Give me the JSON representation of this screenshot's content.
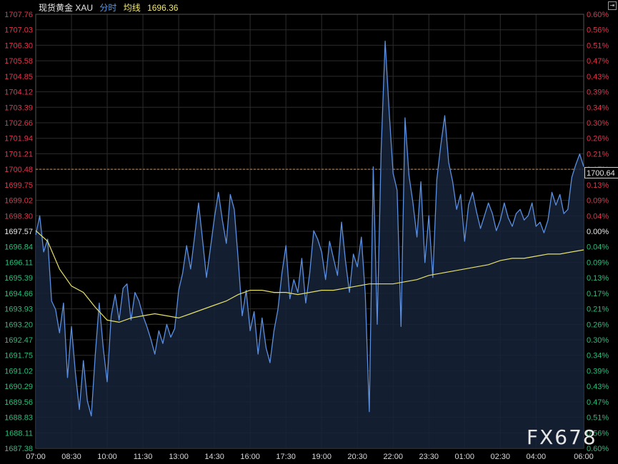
{
  "header": {
    "symbol": "现货黄金 XAU",
    "mode": "分时",
    "avg_label": "均线",
    "avg_value": "1696.36"
  },
  "current_price_tag": "1700.64",
  "watermark": "FX678",
  "colors": {
    "background": "#000000",
    "price_line": "#5b8fe0",
    "area_fill": "#16233a",
    "avg_line": "#e6e16a",
    "axis_up": "#e8334a",
    "axis_down": "#26c07a",
    "grid": "#2c2c2c",
    "ref_line": "#d28a4a"
  },
  "chart_data": {
    "type": "line",
    "title": "",
    "xlabel": "",
    "ylabel": "",
    "x_ticks": [
      "07:00",
      "08:30",
      "10:00",
      "11:30",
      "13:00",
      "14:30",
      "16:00",
      "17:30",
      "19:00",
      "20:30",
      "22:00",
      "23:30",
      "01:00",
      "02:30",
      "04:00",
      "06:00"
    ],
    "y_ticks": [
      "1707.76",
      "1707.03",
      "1706.30",
      "1705.58",
      "1704.85",
      "1704.12",
      "1703.39",
      "1702.66",
      "1701.94",
      "1701.21",
      "1700.48",
      "1699.75",
      "1699.02",
      "1698.30",
      "1697.57",
      "1696.84",
      "1696.11",
      "1695.39",
      "1694.66",
      "1693.93",
      "1693.20",
      "1692.47",
      "1691.75",
      "1691.02",
      "1690.29",
      "1689.56",
      "1688.83",
      "1688.11",
      "1687.38"
    ],
    "pct_ticks": [
      "0.60%",
      "0.56%",
      "0.51%",
      "0.47%",
      "0.43%",
      "0.39%",
      "0.34%",
      "0.30%",
      "0.26%",
      "0.21%",
      "0.17%",
      "0.13%",
      "0.09%",
      "0.04%",
      "0.00%",
      "0.04%",
      "0.09%",
      "0.13%",
      "0.17%",
      "0.21%",
      "0.26%",
      "0.30%",
      "0.34%",
      "0.39%",
      "0.43%",
      "0.47%",
      "0.51%",
      "0.56%",
      "0.60%"
    ],
    "ylim": [
      1687.38,
      1707.76
    ],
    "prev_close": 1697.57,
    "ref_price": 1700.48,
    "grid": true,
    "series": [
      {
        "key": "price",
        "points": [
          [
            "07:00",
            1697.4
          ],
          [
            "07:10",
            1698.3
          ],
          [
            "07:20",
            1696.6
          ],
          [
            "07:30",
            1697.2
          ],
          [
            "07:40",
            1694.3
          ],
          [
            "07:50",
            1693.9
          ],
          [
            "08:00",
            1692.8
          ],
          [
            "08:10",
            1694.2
          ],
          [
            "08:20",
            1690.7
          ],
          [
            "08:30",
            1693.1
          ],
          [
            "08:40",
            1690.9
          ],
          [
            "08:50",
            1689.2
          ],
          [
            "09:00",
            1691.5
          ],
          [
            "09:10",
            1689.6
          ],
          [
            "09:20",
            1688.9
          ],
          [
            "09:30",
            1691.8
          ],
          [
            "09:40",
            1694.2
          ],
          [
            "09:50",
            1692.1
          ],
          [
            "10:00",
            1690.5
          ],
          [
            "10:10",
            1693.6
          ],
          [
            "10:20",
            1694.6
          ],
          [
            "10:30",
            1693.4
          ],
          [
            "10:40",
            1694.9
          ],
          [
            "10:50",
            1695.1
          ],
          [
            "11:00",
            1693.4
          ],
          [
            "11:10",
            1694.7
          ],
          [
            "11:20",
            1694.3
          ],
          [
            "11:30",
            1693.6
          ],
          [
            "11:40",
            1693.1
          ],
          [
            "11:50",
            1692.5
          ],
          [
            "12:00",
            1691.8
          ],
          [
            "12:10",
            1692.9
          ],
          [
            "12:20",
            1692.3
          ],
          [
            "12:30",
            1693.2
          ],
          [
            "12:40",
            1692.6
          ],
          [
            "12:50",
            1693.0
          ],
          [
            "13:00",
            1694.8
          ],
          [
            "13:10",
            1695.6
          ],
          [
            "13:20",
            1696.9
          ],
          [
            "13:30",
            1695.8
          ],
          [
            "13:40",
            1697.3
          ],
          [
            "13:50",
            1698.9
          ],
          [
            "14:00",
            1697.2
          ],
          [
            "14:10",
            1695.4
          ],
          [
            "14:20",
            1696.8
          ],
          [
            "14:30",
            1698.2
          ],
          [
            "14:40",
            1699.4
          ],
          [
            "14:50",
            1698.1
          ],
          [
            "15:00",
            1697.0
          ],
          [
            "15:10",
            1699.3
          ],
          [
            "15:20",
            1698.6
          ],
          [
            "15:30",
            1696.2
          ],
          [
            "15:40",
            1693.6
          ],
          [
            "15:50",
            1694.8
          ],
          [
            "16:00",
            1692.9
          ],
          [
            "16:10",
            1693.8
          ],
          [
            "16:20",
            1691.8
          ],
          [
            "16:30",
            1693.5
          ],
          [
            "16:40",
            1692.1
          ],
          [
            "16:50",
            1691.4
          ],
          [
            "17:00",
            1692.9
          ],
          [
            "17:10",
            1693.9
          ],
          [
            "17:20",
            1695.6
          ],
          [
            "17:30",
            1696.9
          ],
          [
            "17:40",
            1694.4
          ],
          [
            "17:50",
            1695.3
          ],
          [
            "18:00",
            1694.7
          ],
          [
            "18:10",
            1696.3
          ],
          [
            "18:20",
            1694.2
          ],
          [
            "18:30",
            1695.6
          ],
          [
            "18:40",
            1697.6
          ],
          [
            "18:50",
            1697.2
          ],
          [
            "19:00",
            1696.6
          ],
          [
            "19:10",
            1695.3
          ],
          [
            "19:20",
            1697.1
          ],
          [
            "19:30",
            1696.3
          ],
          [
            "19:40",
            1695.5
          ],
          [
            "19:50",
            1698.0
          ],
          [
            "20:00",
            1696.2
          ],
          [
            "20:10",
            1694.7
          ],
          [
            "20:20",
            1696.5
          ],
          [
            "20:30",
            1695.9
          ],
          [
            "20:40",
            1697.3
          ],
          [
            "20:50",
            1694.6
          ],
          [
            "21:00",
            1689.1
          ],
          [
            "21:10",
            1700.6
          ],
          [
            "21:20",
            1693.2
          ],
          [
            "21:30",
            1701.4
          ],
          [
            "21:40",
            1706.5
          ],
          [
            "21:50",
            1703.2
          ],
          [
            "22:00",
            1700.3
          ],
          [
            "22:10",
            1699.5
          ],
          [
            "22:20",
            1693.1
          ],
          [
            "22:30",
            1702.9
          ],
          [
            "22:40",
            1700.2
          ],
          [
            "22:50",
            1698.9
          ],
          [
            "23:00",
            1697.3
          ],
          [
            "23:10",
            1699.9
          ],
          [
            "23:20",
            1696.1
          ],
          [
            "23:30",
            1698.3
          ],
          [
            "23:40",
            1695.4
          ],
          [
            "23:50",
            1700.0
          ],
          [
            "00:00",
            1701.6
          ],
          [
            "00:10",
            1703.0
          ],
          [
            "00:20",
            1700.8
          ],
          [
            "00:30",
            1699.9
          ],
          [
            "00:40",
            1698.6
          ],
          [
            "00:50",
            1699.3
          ],
          [
            "01:00",
            1697.1
          ],
          [
            "01:10",
            1698.8
          ],
          [
            "01:20",
            1699.4
          ],
          [
            "01:30",
            1698.5
          ],
          [
            "01:40",
            1697.7
          ],
          [
            "01:50",
            1698.3
          ],
          [
            "02:00",
            1698.9
          ],
          [
            "02:10",
            1698.4
          ],
          [
            "02:20",
            1697.6
          ],
          [
            "02:30",
            1698.1
          ],
          [
            "02:40",
            1698.9
          ],
          [
            "02:50",
            1698.2
          ],
          [
            "03:00",
            1697.8
          ],
          [
            "03:10",
            1698.4
          ],
          [
            "03:20",
            1698.6
          ],
          [
            "03:30",
            1698.1
          ],
          [
            "03:40",
            1698.3
          ],
          [
            "03:50",
            1698.9
          ],
          [
            "04:00",
            1697.8
          ],
          [
            "04:10",
            1698.0
          ],
          [
            "04:20",
            1697.5
          ],
          [
            "04:30",
            1698.1
          ],
          [
            "04:40",
            1699.4
          ],
          [
            "04:50",
            1698.8
          ],
          [
            "05:00",
            1699.3
          ],
          [
            "05:10",
            1698.4
          ],
          [
            "05:20",
            1698.6
          ],
          [
            "05:30",
            1700.1
          ],
          [
            "05:40",
            1700.7
          ],
          [
            "05:50",
            1701.2
          ],
          [
            "06:00",
            1700.6
          ]
        ]
      },
      {
        "key": "average",
        "points": [
          [
            "07:00",
            1697.6
          ],
          [
            "07:30",
            1697.1
          ],
          [
            "08:00",
            1695.8
          ],
          [
            "08:30",
            1695.0
          ],
          [
            "09:00",
            1694.7
          ],
          [
            "09:30",
            1694.0
          ],
          [
            "10:00",
            1693.4
          ],
          [
            "10:30",
            1693.3
          ],
          [
            "11:00",
            1693.5
          ],
          [
            "11:30",
            1693.6
          ],
          [
            "12:00",
            1693.7
          ],
          [
            "12:30",
            1693.6
          ],
          [
            "13:00",
            1693.5
          ],
          [
            "13:30",
            1693.7
          ],
          [
            "14:00",
            1693.9
          ],
          [
            "14:30",
            1694.1
          ],
          [
            "15:00",
            1694.3
          ],
          [
            "15:30",
            1694.6
          ],
          [
            "16:00",
            1694.8
          ],
          [
            "16:30",
            1694.8
          ],
          [
            "17:00",
            1694.7
          ],
          [
            "17:30",
            1694.7
          ],
          [
            "18:00",
            1694.6
          ],
          [
            "18:30",
            1694.7
          ],
          [
            "19:00",
            1694.8
          ],
          [
            "19:30",
            1694.8
          ],
          [
            "20:00",
            1694.9
          ],
          [
            "20:30",
            1695.0
          ],
          [
            "21:00",
            1695.1
          ],
          [
            "21:30",
            1695.1
          ],
          [
            "22:00",
            1695.1
          ],
          [
            "22:30",
            1695.2
          ],
          [
            "23:00",
            1695.3
          ],
          [
            "23:30",
            1695.5
          ],
          [
            "00:00",
            1695.6
          ],
          [
            "00:30",
            1695.7
          ],
          [
            "01:00",
            1695.8
          ],
          [
            "01:30",
            1695.9
          ],
          [
            "02:00",
            1696.0
          ],
          [
            "02:30",
            1696.2
          ],
          [
            "03:00",
            1696.3
          ],
          [
            "03:30",
            1696.3
          ],
          [
            "04:00",
            1696.4
          ],
          [
            "04:30",
            1696.5
          ],
          [
            "05:00",
            1696.5
          ],
          [
            "05:30",
            1696.6
          ],
          [
            "06:00",
            1696.7
          ]
        ]
      }
    ]
  }
}
